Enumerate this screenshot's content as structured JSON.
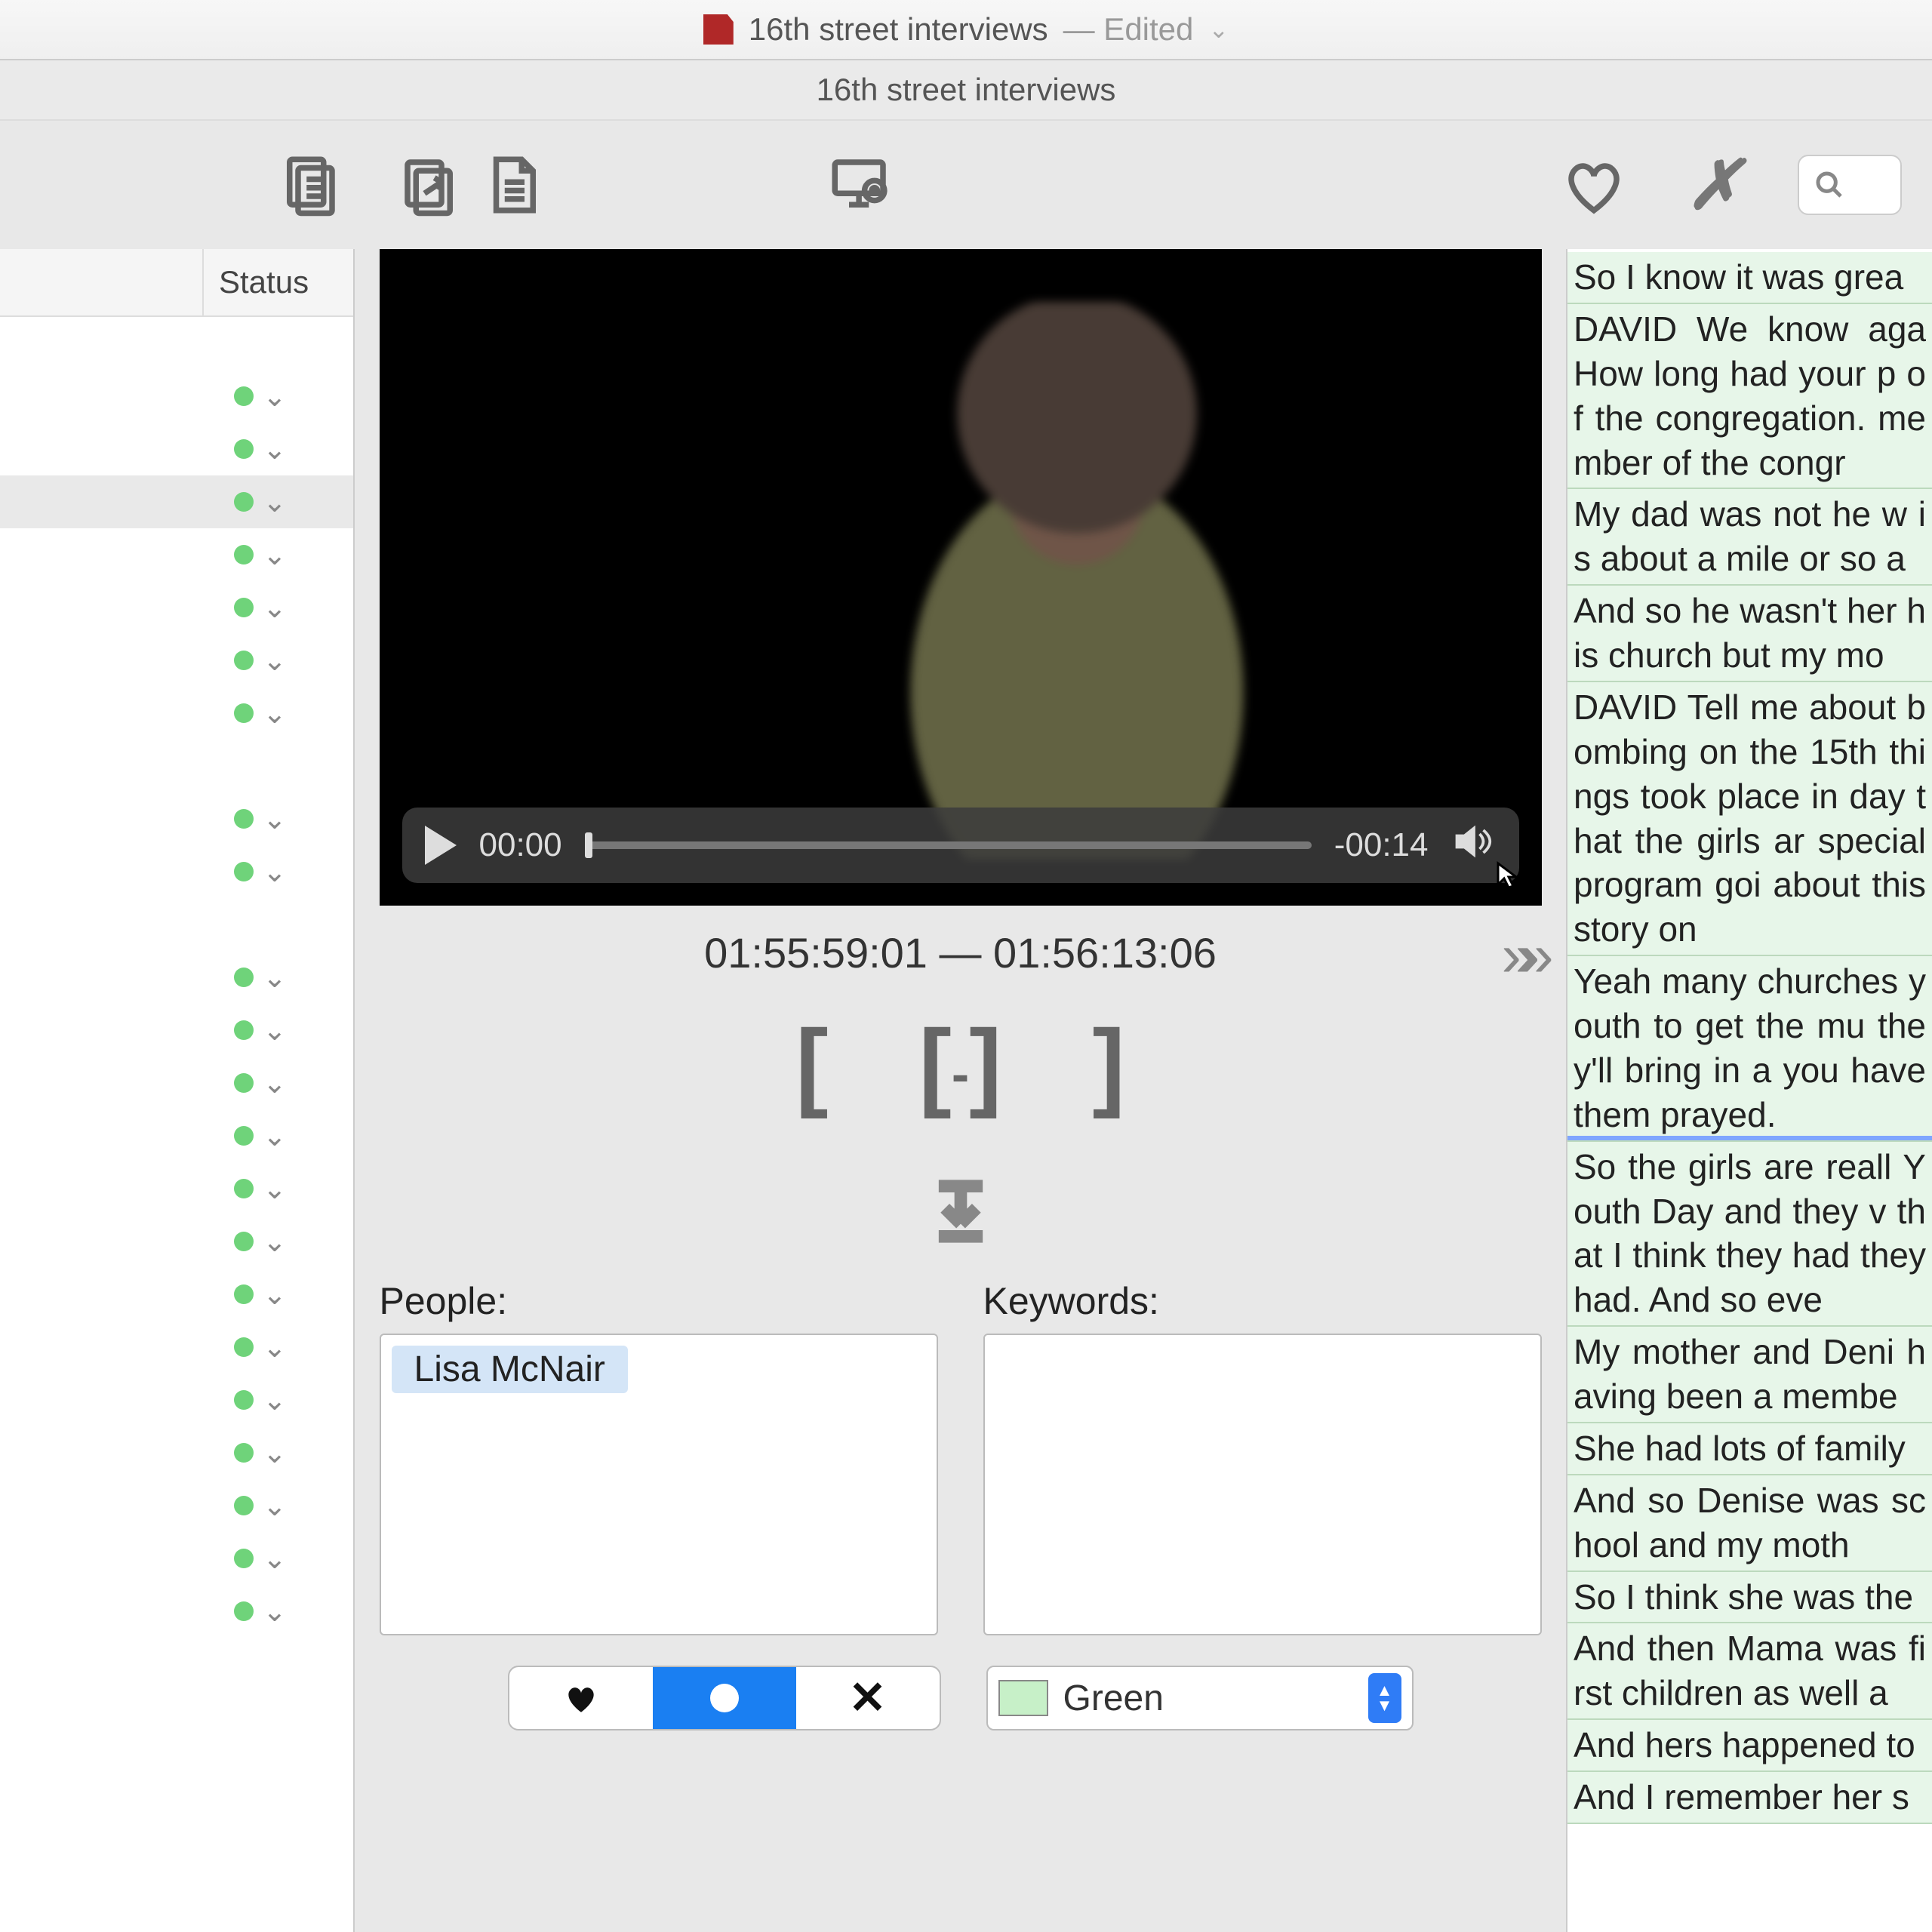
{
  "titlebar": {
    "title": "16th street interviews",
    "edited_suffix": "— Edited",
    "subtitle": "16th street interviews"
  },
  "toolbar": {
    "search_placeholder": ""
  },
  "sidebar": {
    "status_header": "Status",
    "rows": [
      {
        "gap": true
      },
      {
        "dot": "green"
      },
      {
        "dot": "green"
      },
      {
        "dot": "green",
        "selected": true
      },
      {
        "dot": "green"
      },
      {
        "dot": "green"
      },
      {
        "dot": "green"
      },
      {
        "dot": "green"
      },
      {
        "gap": true
      },
      {
        "dot": "green"
      },
      {
        "dot": "green"
      },
      {
        "gap": true
      },
      {
        "dot": "green"
      },
      {
        "dot": "green"
      },
      {
        "dot": "green"
      },
      {
        "dot": "green"
      },
      {
        "dot": "green"
      },
      {
        "dot": "green"
      },
      {
        "dot": "green"
      },
      {
        "dot": "green"
      },
      {
        "dot": "green"
      },
      {
        "dot": "green"
      },
      {
        "dot": "green"
      },
      {
        "dot": "green"
      },
      {
        "dot": "green"
      }
    ]
  },
  "player": {
    "current_time": "00:00",
    "remaining_time": "-00:14",
    "timecode_range": "01:55:59:01 — 01:56:13:06"
  },
  "meta": {
    "people_label": "People:",
    "keywords_label": "Keywords:",
    "people": [
      "Lisa McNair"
    ],
    "keywords": []
  },
  "color_select": {
    "label": "Green"
  },
  "transcript": {
    "paragraphs": [
      "So I know it was grea",
      "DAVID We know aga How long had your p of the congregation. member of the congr",
      "My dad was not he w is about a mile or so a",
      "And so he wasn't her his church but my mo",
      "DAVID Tell me about bombing on the 15th things took place in day that the girls ar special program goi about this story on",
      "Yeah many churches youth to get the mu they'll bring in a you have them prayed.",
      "So the girls are reall Youth Day and they v that I think they had they had. And so eve",
      "My mother and Deni having been a membe",
      "She had lots of family",
      "And so Denise was school and my moth",
      "So I think she was the",
      "And then Mama was first children as well a",
      "And hers happened to",
      "And I remember her s"
    ],
    "highlight_index": 5
  }
}
